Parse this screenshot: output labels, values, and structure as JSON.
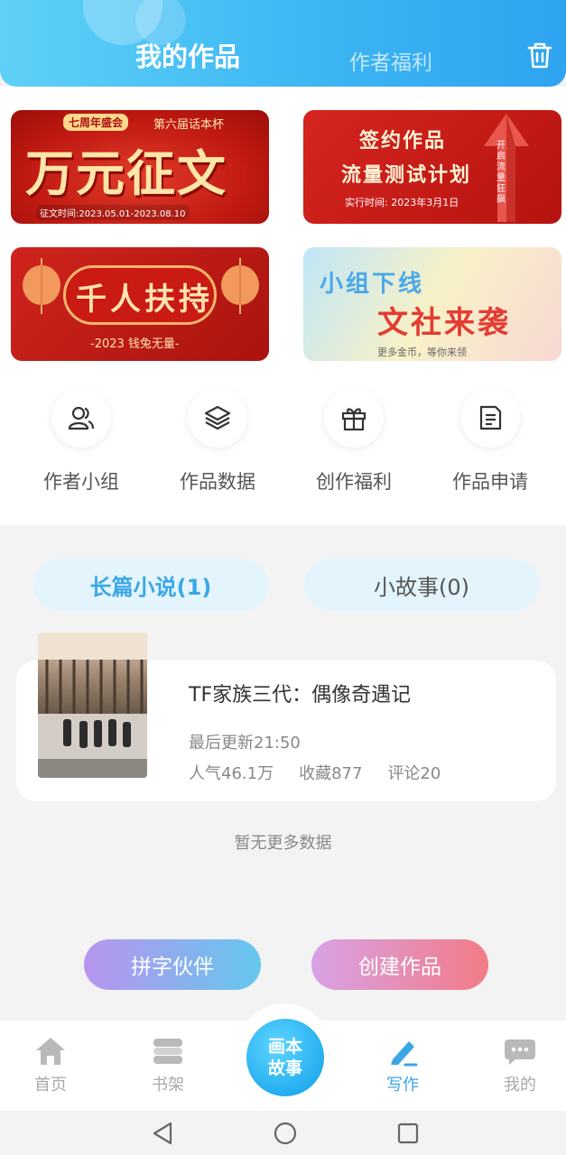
{
  "header": {
    "tabs": [
      {
        "label": "我的作品",
        "active": true
      },
      {
        "label": "作者福利",
        "active": false
      }
    ],
    "trash_icon": "trash-icon"
  },
  "banners": [
    {
      "small": "七周年盛会",
      "small2": "第六届话本杯",
      "big": "万元征文",
      "date": "征文时间:2023.05.01-2023.08.10"
    },
    {
      "line1": "签约作品",
      "line2": "流量测试计划",
      "date": "实行时间: 2023年3月1日",
      "side": "开启流量狂飙"
    },
    {
      "big": "千人扶持",
      "sub": "-2023 钱兔无量-"
    },
    {
      "line1": "小组下线",
      "line2": "文社来袭",
      "sub": "更多金币，等你来领"
    }
  ],
  "grid": [
    {
      "label": "作者小组",
      "icon": "users-icon"
    },
    {
      "label": "作品数据",
      "icon": "layers-icon"
    },
    {
      "label": "创作福利",
      "icon": "gift-icon"
    },
    {
      "label": "作品申请",
      "icon": "document-icon"
    }
  ],
  "categories": [
    {
      "label": "长篇小说(1)",
      "active": true
    },
    {
      "label": "小故事(0)",
      "active": false
    }
  ],
  "work": {
    "title": "TF家族三代：偶像奇遇记",
    "updated": "最后更新21:50",
    "popularity": "人气46.1万",
    "favorites": "收藏877",
    "comments": "评论20"
  },
  "no_more": "暂无更多数据",
  "actions": {
    "partner": "拼字伙伴",
    "create": "创建作品"
  },
  "nav": {
    "items": [
      {
        "label": "首页",
        "icon": "home-icon"
      },
      {
        "label": "书架",
        "icon": "bookshelf-icon"
      },
      {
        "label": "写作",
        "icon": "pen-icon",
        "active": true
      },
      {
        "label": "我的",
        "icon": "chat-icon"
      }
    ],
    "center": "画本\n故事"
  },
  "colors": {
    "accent": "#3aa7e4",
    "header_start": "#5fd1f7",
    "header_end": "#2ea3f0"
  }
}
